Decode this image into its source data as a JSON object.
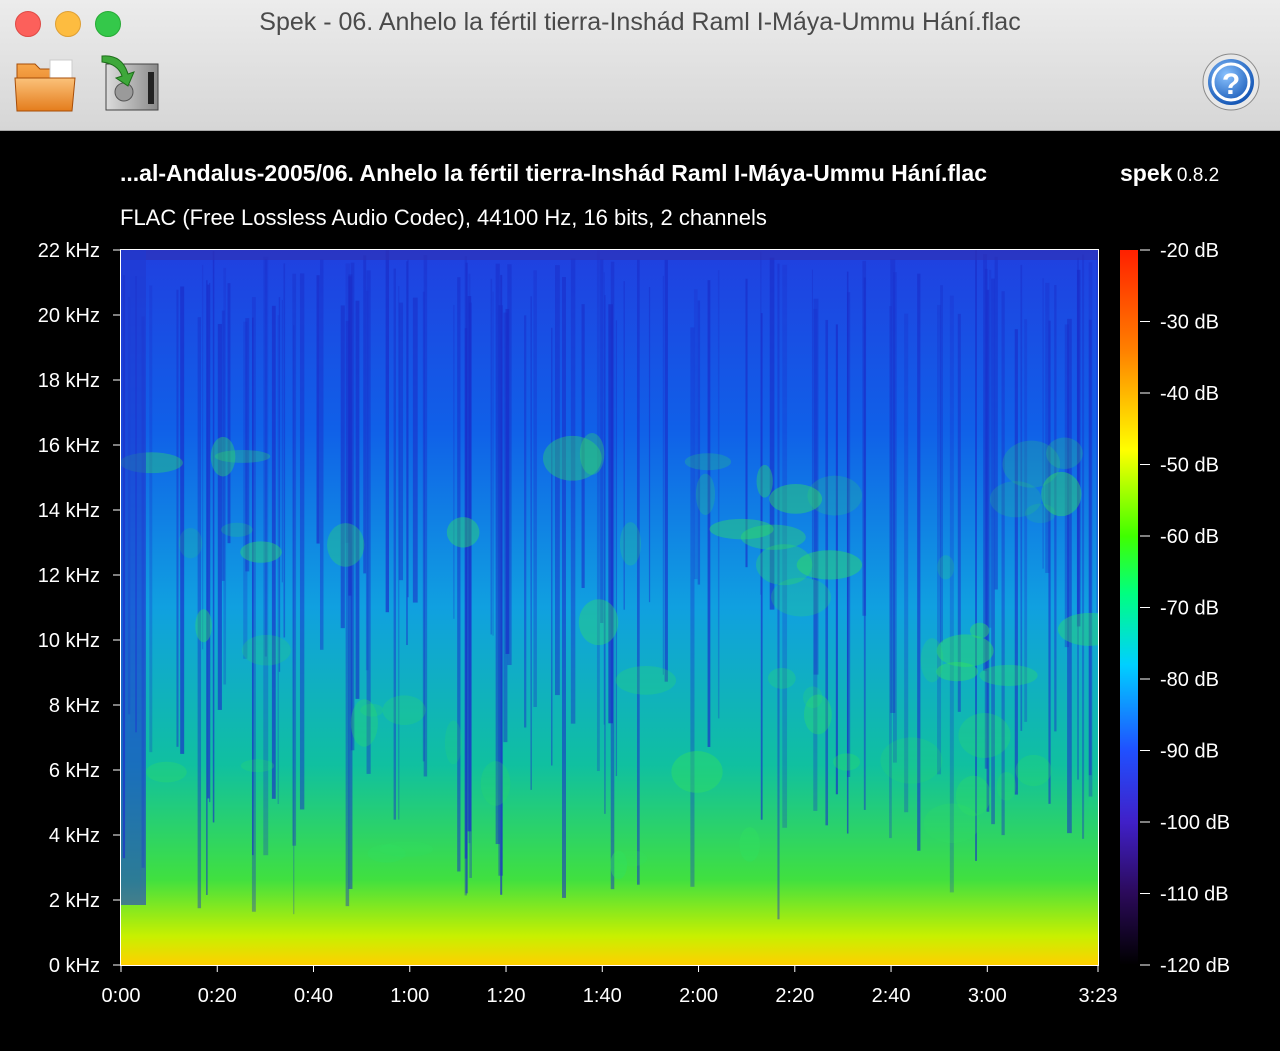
{
  "window": {
    "title": "Spek - 06. Anhelo la fértil tierra-Inshád Raml I-Máya-Ummu Hání.flac"
  },
  "toolbar": {
    "open_icon": "folder-icon",
    "save_icon": "save-export-icon",
    "help_icon": "help-icon"
  },
  "spectrum": {
    "file_title": "...al-Andalus-2005/06. Anhelo la fértil tierra-Inshád Raml I-Máya-Ummu Hání.flac",
    "app_name": "spek",
    "app_version": "0.8.2",
    "format_info": "FLAC (Free Lossless Audio Codec), 44100 Hz, 16 bits, 2 channels"
  },
  "chart_data": {
    "type": "heatmap",
    "title": "...al-Andalus-2005/06. Anhelo la fértil tierra-Inshád Raml I-Máya-Ummu Hání.flac",
    "subtitle": "FLAC (Free Lossless Audio Codec), 44100 Hz, 16 bits, 2 channels",
    "xlabel": "",
    "ylabel": "",
    "x_ticks": [
      "0:00",
      "0:20",
      "0:40",
      "1:00",
      "1:20",
      "1:40",
      "2:00",
      "2:20",
      "2:40",
      "3:00",
      "3:23"
    ],
    "x_tick_seconds": [
      0,
      20,
      40,
      60,
      80,
      100,
      120,
      140,
      160,
      180,
      203
    ],
    "xlim": [
      0,
      203
    ],
    "y_ticks": [
      "0 kHz",
      "2 kHz",
      "4 kHz",
      "6 kHz",
      "8 kHz",
      "10 kHz",
      "12 kHz",
      "14 kHz",
      "16 kHz",
      "18 kHz",
      "20 kHz",
      "22 kHz"
    ],
    "y_tick_khz": [
      0,
      2,
      4,
      6,
      8,
      10,
      12,
      14,
      16,
      18,
      20,
      22
    ],
    "ylim": [
      0,
      22
    ],
    "colorbar_ticks": [
      "-20 dB",
      "-30 dB",
      "-40 dB",
      "-50 dB",
      "-60 dB",
      "-70 dB",
      "-80 dB",
      "-90 dB",
      "-100 dB",
      "-110 dB",
      "-120 dB"
    ],
    "colorbar_db": [
      -20,
      -30,
      -40,
      -50,
      -60,
      -70,
      -80,
      -90,
      -100,
      -110,
      -120
    ],
    "colorbar_range": [
      -120,
      -20
    ],
    "colormap": [
      "#000000",
      "#2b0a5a",
      "#4020c8",
      "#2050ff",
      "#00d0ff",
      "#00ff40",
      "#c8ff00",
      "#ffe000",
      "#ff8000",
      "#ff2000"
    ],
    "grid": false
  }
}
